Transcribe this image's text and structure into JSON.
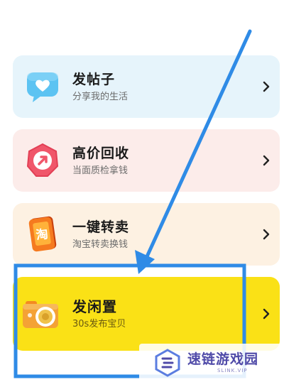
{
  "menu": {
    "items": [
      {
        "title": "发帖子",
        "subtitle": "分享我的生活",
        "icon": "heart-chat-icon"
      },
      {
        "title": "高价回收",
        "subtitle": "当面质检拿钱",
        "icon": "recycle-arrow-icon"
      },
      {
        "title": "一键转卖",
        "subtitle": "淘宝转卖换钱",
        "icon": "taobao-phone-icon",
        "icon_text": "淘"
      },
      {
        "title": "发闲置",
        "subtitle": "30s发布宝贝",
        "icon": "camera-icon"
      }
    ]
  },
  "watermark": {
    "title": "速链游戏园",
    "subtitle": "SLINK.VIP"
  },
  "colors": {
    "annotation_blue": "#2f8be6",
    "highlight_yellow": "#fae116"
  }
}
